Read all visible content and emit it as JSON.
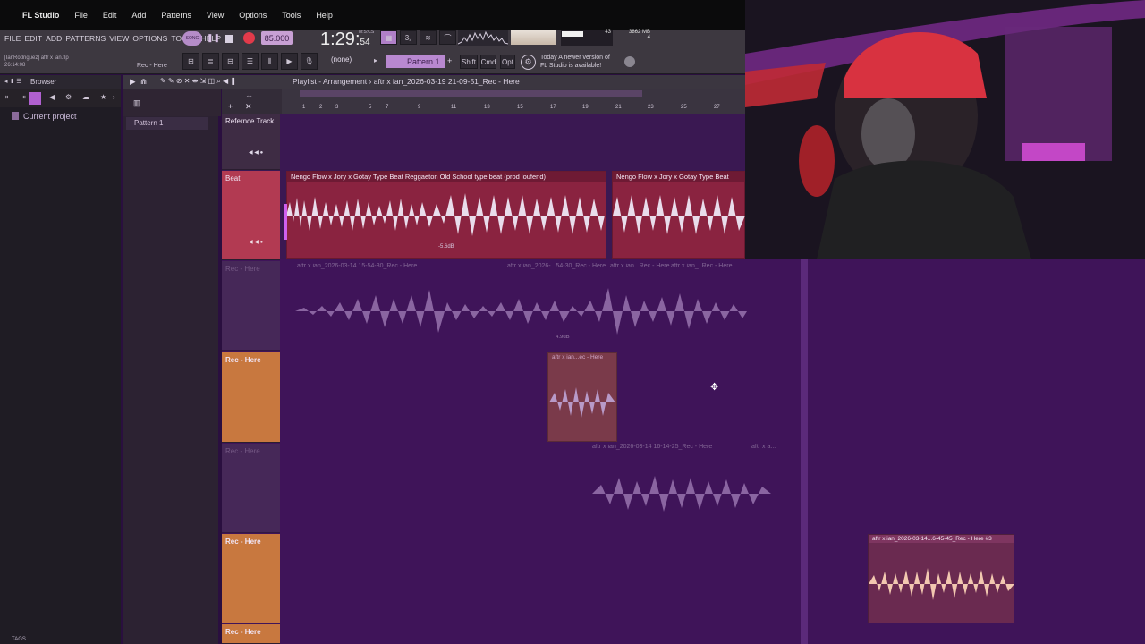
{
  "mac_menu": {
    "app": "FL Studio",
    "items": [
      "File",
      "Edit",
      "Add",
      "Patterns",
      "View",
      "Options",
      "Tools",
      "Help"
    ]
  },
  "fl_menu": [
    "FILE",
    "EDIT",
    "ADD",
    "PATTERNS",
    "VIEW",
    "OPTIONS",
    "TOOLS",
    "HELP"
  ],
  "record_info": {
    "user": "[IanRodriguez] aftr x ian.flp",
    "elapsed": "26:14:08",
    "hint": "Rec - Here"
  },
  "transport": {
    "tempo": "85.000",
    "time_main": "1:29",
    "time_sub": "54",
    "time_label": "M:S:CS"
  },
  "monitor": {
    "cpu": "43",
    "mem": "3862 MB",
    "voices": "4"
  },
  "toolbar2": {
    "preset": "(none)",
    "pattern": "Pattern 1",
    "keys": [
      "Shift",
      "Cmd",
      "Opt"
    ],
    "news_line1": "Today  A newer version of",
    "news_line2": "FL Studio is available!"
  },
  "browser": {
    "title": "Browser",
    "current_project": "Current project",
    "tags": "TAGS"
  },
  "patterns": {
    "item1": "Pattern 1"
  },
  "playlist": {
    "title": "Playlist - Arrangement",
    "song": "aftr x ian_2026-03-19 21-09-51_Rec - Here"
  },
  "timeline_ticks": [
    "1",
    "2",
    "3",
    "5",
    "7",
    "9",
    "11",
    "13",
    "15",
    "17",
    "19",
    "21",
    "23",
    "25",
    "27"
  ],
  "tracks": {
    "t1": "Refernce Track",
    "t2": "Beat",
    "t3": "Rec - Here",
    "t4": "Rec - Here",
    "t5": "Rec - Here",
    "t6": "Rec - Here",
    "t7": "Rec - Here"
  },
  "clips": {
    "beat1": "Nengo Flow x Jory x Gotay Type Beat  Reggaeton Old School type beat (prod loufend)",
    "beat2": "Nengo Flow x Jory x Gotay Type Beat",
    "beat_db": "-5.6dB",
    "rec_a": "aftr x ian_2026-03-14 15-54-30_Rec - Here",
    "rec_b": "aftr x ian_2026-...54-30_Rec - Here",
    "rec_c": "aftr x ian...Rec - Here",
    "rec_d": "aftr x ian_..Rec - Here",
    "rec_db": "4.9dB",
    "rec_e": "aftr x ian...ec - Here",
    "rec_f": "aftr x ian_2026-03-14 16-14-25_Rec - Here",
    "rec_f2": "aftr x a...",
    "rec_g": "aftr x ian_2026-03-14...6-45-45_Rec - Here #3"
  },
  "colors": {
    "accent": "#c8a0d4",
    "beat_track": "#b23a52",
    "rec_track": "#c8783f",
    "playlist_bg": "#3f1459",
    "beat_clip": "#8a2340",
    "wave_light": "#e9dceb"
  }
}
